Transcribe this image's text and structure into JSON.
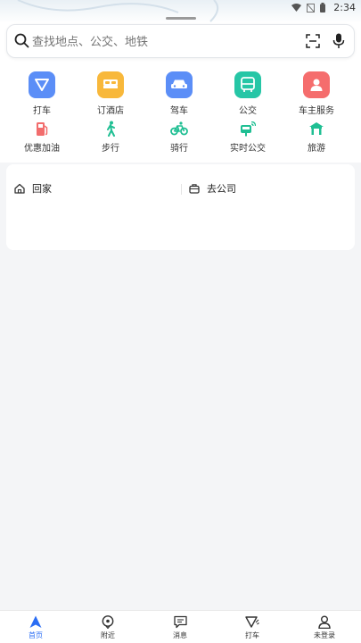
{
  "status_bar": {
    "time": "2:34"
  },
  "search": {
    "placeholder": "查找地点、公交、地铁"
  },
  "primary_services": [
    {
      "label": "打车",
      "color": "#5b8ef7"
    },
    {
      "label": "订酒店",
      "color": "#f8b83b"
    },
    {
      "label": "驾车",
      "color": "#5b8ef7"
    },
    {
      "label": "公交",
      "color": "#26c6a6"
    },
    {
      "label": "车主服务",
      "color": "#f56d6d"
    }
  ],
  "secondary_services": [
    {
      "label": "优惠加油",
      "color": "#f26d6d"
    },
    {
      "label": "步行",
      "color": "#1fbf93"
    },
    {
      "label": "骑行",
      "color": "#1fbf93"
    },
    {
      "label": "实时公交",
      "color": "#1fbf93"
    },
    {
      "label": "旅游",
      "color": "#1fbf93"
    }
  ],
  "shortcuts": {
    "home": "回家",
    "work": "去公司"
  },
  "bottom_nav": [
    {
      "label": "首页"
    },
    {
      "label": "附近"
    },
    {
      "label": "消息"
    },
    {
      "label": "打车"
    },
    {
      "label": "未登录"
    }
  ],
  "colors": {
    "accent": "#2a6df4"
  }
}
